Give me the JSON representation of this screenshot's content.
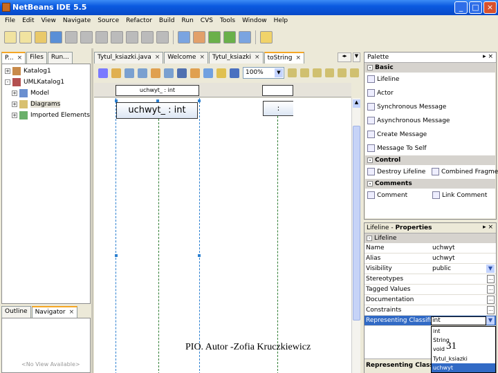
{
  "window": {
    "title": "NetBeans IDE 5.5",
    "controls": [
      "_",
      "□",
      "×"
    ]
  },
  "menu": [
    "File",
    "Edit",
    "View",
    "Navigate",
    "Source",
    "Refactor",
    "Build",
    "Run",
    "CVS",
    "Tools",
    "Window",
    "Help"
  ],
  "left": {
    "tabs": [
      {
        "label": "P...",
        "active": true
      },
      {
        "label": "Files"
      },
      {
        "label": "Run..."
      }
    ],
    "tree": [
      {
        "label": "Katalog1",
        "level": 0,
        "exp": "+"
      },
      {
        "label": "UMLKatalog1",
        "level": 0,
        "exp": "-"
      },
      {
        "label": "Model",
        "level": 1,
        "exp": "+"
      },
      {
        "label": "Diagrams",
        "level": 1,
        "exp": "+",
        "selected": true
      },
      {
        "label": "Imported Elements",
        "level": 1,
        "exp": "+"
      }
    ],
    "bottom_tabs": [
      {
        "label": "Outline"
      },
      {
        "label": "Navigator",
        "active": true
      }
    ],
    "no_view": "<No View Available>"
  },
  "editor": {
    "tabs": [
      {
        "label": "Tytul_ksiazki.java"
      },
      {
        "label": "Welcome"
      },
      {
        "label": "Tytul_ksiazki"
      },
      {
        "label": "toString",
        "active": true
      }
    ],
    "zoom": "100%",
    "header_label": "uchwyt_ : int",
    "lifelines": [
      {
        "label": "uchwyt_ : int"
      },
      {
        "label": ":"
      }
    ]
  },
  "palette": {
    "title": "Palette",
    "sections": [
      {
        "name": "Basic",
        "items": [
          "Lifeline",
          "Actor",
          "Synchronous Message",
          "Asynchronous Message",
          "Create Message",
          "Message To Self"
        ]
      },
      {
        "name": "Control",
        "items": [
          "Destroy Lifeline",
          "Combined Fragment"
        ]
      },
      {
        "name": "Comments",
        "items": [
          "Comment",
          "Link Comment"
        ]
      }
    ]
  },
  "properties": {
    "title_prefix": "Lifeline - ",
    "title_bold": "Properties",
    "group": "Lifeline",
    "rows": [
      {
        "k": "Name",
        "v": "uchwyt"
      },
      {
        "k": "Alias",
        "v": "uchwyt"
      },
      {
        "k": "Visibility",
        "v": "public",
        "ctl": "dropdown"
      },
      {
        "k": "Stereotypes",
        "v": "",
        "ctl": "button"
      },
      {
        "k": "Tagged Values",
        "v": "",
        "ctl": "button"
      },
      {
        "k": "Documentation",
        "v": "",
        "ctl": "button"
      },
      {
        "k": "Constraints",
        "v": "",
        "ctl": "button"
      },
      {
        "k": "Representing Classifier",
        "v": "int",
        "ctl": "dropdown",
        "selected": true
      }
    ],
    "dropdown_options": [
      "int",
      "String",
      "void",
      "Tytul_ksiazki",
      "uchwyt"
    ],
    "dropdown_selected": "uchwyt",
    "description_title": "Representing Classifier"
  },
  "footer": {
    "text": "PIO.  Autor -Zofia Kruczkiewicz",
    "page": "31"
  },
  "colors": {
    "titlebar": "#0a5ae0",
    "selection": "#316ac5",
    "lifeline_dash": "#2e7d32",
    "selection_dash": "#2a7fd0"
  }
}
